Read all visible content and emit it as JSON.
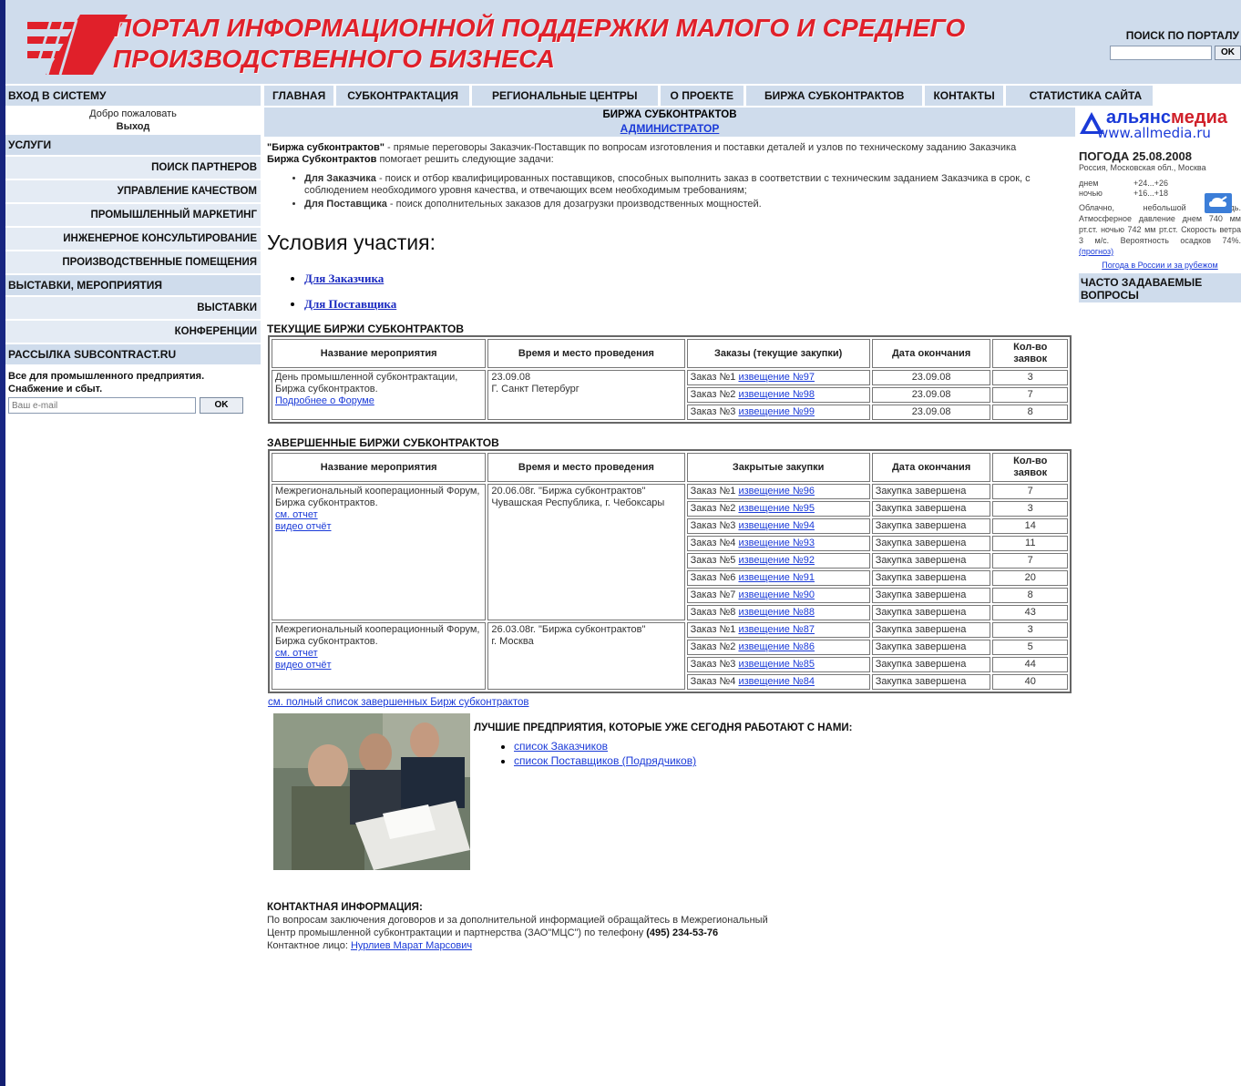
{
  "header": {
    "title_line1": "ПОРТАЛ ИНФОРМАЦИОННОЙ ПОДДЕРЖКИ МАЛОГО И СРЕДНЕГО",
    "title_line2": "ПРОИЗВОДСТВЕННОГО БИЗНЕСА",
    "search_title": "ПОИСК ПО ПОРТАЛУ",
    "search_button": "OK",
    "brand_color": "#e0202a"
  },
  "nav": [
    "ГЛАВНАЯ",
    "СУБКОНТРАКТАЦИЯ",
    "РЕГИОНАЛЬНЫЕ ЦЕНТРЫ",
    "О ПРОЕКТЕ",
    "БИРЖА СУБКОНТРАКТОВ",
    "КОНТАКТЫ",
    "СТАТИСТИКА САЙТА"
  ],
  "left": {
    "login_header": "ВХОД В СИСТЕМУ",
    "welcome": "Добро пожаловать",
    "logout": "Выход",
    "services_header": "УСЛУГИ",
    "services": [
      "ПОИСК ПАРТНЕРОВ",
      "УПРАВЛЕНИЕ КАЧЕСТВОМ",
      "ПРОМЫШЛЕННЫЙ МАРКЕТИНГ",
      "ИНЖЕНЕРНОЕ КОНСУЛЬТИРОВАНИЕ",
      "ПРОИЗВОДСТВЕННЫЕ ПОМЕЩЕНИЯ"
    ],
    "events_header": "ВЫСТАВКИ, МЕРОПРИЯТИЯ",
    "events": [
      "ВЫСТАВКИ",
      "КОНФЕРЕНЦИИ"
    ],
    "mailing_header": "РАССЫЛКА SUBCONTRACT.RU",
    "mailing_text_1": "Все для промышленного предприятия.",
    "mailing_text_2": "Снабжение и сбыт.",
    "email_placeholder": "Ваш e-mail",
    "email_button": "OK"
  },
  "center": {
    "header_title": "БИРЖА СУБКОНТРАКТОВ",
    "header_link": "АДМИНИСТРАТОР",
    "intro_bold": "\"Биржа субконтрактов\"",
    "intro_rest": " - прямые переговоры Заказчик-Поставщик по вопросам изготовления и поставки  деталей и узлов по техническому заданию Заказчика",
    "intro2_bold": "Биржа Субконтрактов",
    "intro2_rest": " помогает решить следующие задачи:",
    "tasks": [
      {
        "bold": "Для Заказчика",
        "text": " - поиск и отбор квалифицированных поставщиков, способных выполнить заказ в соответствии с техническим заданием Заказчика в срок, с соблюдением необходимого уровня качества, и отвечающих всем необходимым требованиям;"
      },
      {
        "bold": "Для Поставщика",
        "text": " - поиск дополнительных заказов для дозагрузки производственных мощностей."
      }
    ],
    "conditions_title": "Условия участия:",
    "conditions_links": [
      "Для Заказчика",
      "Для Поставщика"
    ],
    "current_title": "ТЕКУЩИЕ БИРЖИ СУБКОНТРАКТОВ",
    "current_headers": [
      "Название мероприятия",
      "Время и место проведения",
      "Заказы (текущие закупки)",
      "Дата окончания",
      "Кол-во заявок"
    ],
    "current_event": {
      "name": "День промышленной субконтрактации, Биржа субконтрактов.",
      "link": "Подробнее о Форуме",
      "date": "23.09.08",
      "place": "Г. Санкт Петербург",
      "rows": [
        {
          "order": "Заказ №1 ",
          "link": "извещение  №97",
          "end": "23.09.08",
          "count": "3"
        },
        {
          "order": "Заказ №2 ",
          "link": "извещение  №98",
          "end": "23.09.08",
          "count": "7"
        },
        {
          "order": "Заказ №3 ",
          "link": "извещение  №99",
          "end": "23.09.08",
          "count": "8"
        }
      ]
    },
    "finished_title": "ЗАВЕРШЕННЫЕ БИРЖИ СУБКОНТРАКТОВ",
    "finished_headers": [
      "Название мероприятия",
      "Время и место проведения",
      "Закрытые закупки",
      "Дата окончания",
      "Кол-во заявок"
    ],
    "finished_events": [
      {
        "name": "Межрегиональный кооперационный Форум, Биржа субконтрактов.",
        "report": "см. отчет",
        "video": "видео отчёт",
        "when": "20.06.08г. \"Биржа субконтрактов\"",
        "place": "Чувашская Республика, г. Чебоксары",
        "rows": [
          {
            "order": "Заказ №1 ",
            "link": "извещение  №96",
            "end": "Закупка завершена",
            "count": "7"
          },
          {
            "order": "Заказ №2 ",
            "link": "извещение  №95",
            "end": "Закупка завершена",
            "count": "3"
          },
          {
            "order": "Заказ №3 ",
            "link": "извещение  №94",
            "end": "Закупка завершена",
            "count": "14"
          },
          {
            "order": "Заказ №4 ",
            "link": "извещение  №93",
            "end": "Закупка завершена",
            "count": "11"
          },
          {
            "order": "Заказ №5 ",
            "link": "извещение  №92",
            "end": "Закупка завершена",
            "count": "7"
          },
          {
            "order": "Заказ №6 ",
            "link": "извещение  №91",
            "end": "Закупка завершена",
            "count": "20"
          },
          {
            "order": "Заказ №7 ",
            "link": "извещение  №90",
            "end": "Закупка завершена",
            "count": "8"
          },
          {
            "order": "Заказ №8 ",
            "link": "извещение  №88",
            "end": "Закупка завершена",
            "count": "43"
          }
        ]
      },
      {
        "name": "Межрегиональный кооперационный Форум, Биржа субконтрактов.",
        "report": "см. отчет",
        "video": "видео отчёт",
        "when": "26.03.08г. \"Биржа субконтрактов\"",
        "place": "г. Москва",
        "rows": [
          {
            "order": "Заказ №1 ",
            "link": "извещение  №87",
            "end": "Закупка завершена",
            "count": "3"
          },
          {
            "order": "Заказ №2 ",
            "link": "извещение  №86",
            "end": "Закупка завершена",
            "count": "5"
          },
          {
            "order": "Заказ №3 ",
            "link": "извещение  №85",
            "end": "Закупка завершена",
            "count": "44"
          },
          {
            "order": "Заказ №4 ",
            "link": "извещение  №84",
            "end": "Закупка завершена",
            "count": "40"
          }
        ]
      }
    ],
    "full_list_link": "см. полный список завершенных  Бирж субконтрактов",
    "best_title": "ЛУЧШИЕ ПРЕДПРИЯТИЯ, КОТОРЫЕ УЖЕ СЕГОДНЯ РАБОТАЮТ С НАМИ:",
    "best_links": [
      "список Заказчиков",
      "список Поставщиков (Подрядчиков)"
    ],
    "contact_title": "КОНТАКТНАЯ ИНФОРМАЦИЯ:",
    "contact_text_1": "По вопросам заключения договоров и за дополнительной информацией обращайтесь в Межрегиональный",
    "contact_text_2": "Центр промышленной субконтрактации и партнерства (ЗАО\"МЦС\") по телефону ",
    "contact_phone": "(495) 234-53-76",
    "contact_person_label": "Контактное лицо: ",
    "contact_person": "Нурлиев Марат Марсович"
  },
  "right": {
    "logo_word1": "альянс",
    "logo_word2": "медиа",
    "logo_url": "www.allmedia.ru",
    "weather_title": "ПОГОДА 25.08.2008",
    "location": "Россия, Московская обл., Москва",
    "day_label": "днем",
    "day_temp": "+24...+26",
    "night_label": "ночью",
    "night_temp": "+16...+18",
    "description": "Облачно, небольшой дождь. Атмосферное давление днем 740 мм рт.ст. ночью 742 мм рт.ст. Скорость ветра 3 м/с. Вероятность осадков 74%.",
    "forecast_link": "(прогноз)",
    "weather_link": "Погода в России и за рубежом",
    "faq_header": "ЧАСТО ЗАДАВАЕМЫЕ ВОПРОСЫ"
  }
}
